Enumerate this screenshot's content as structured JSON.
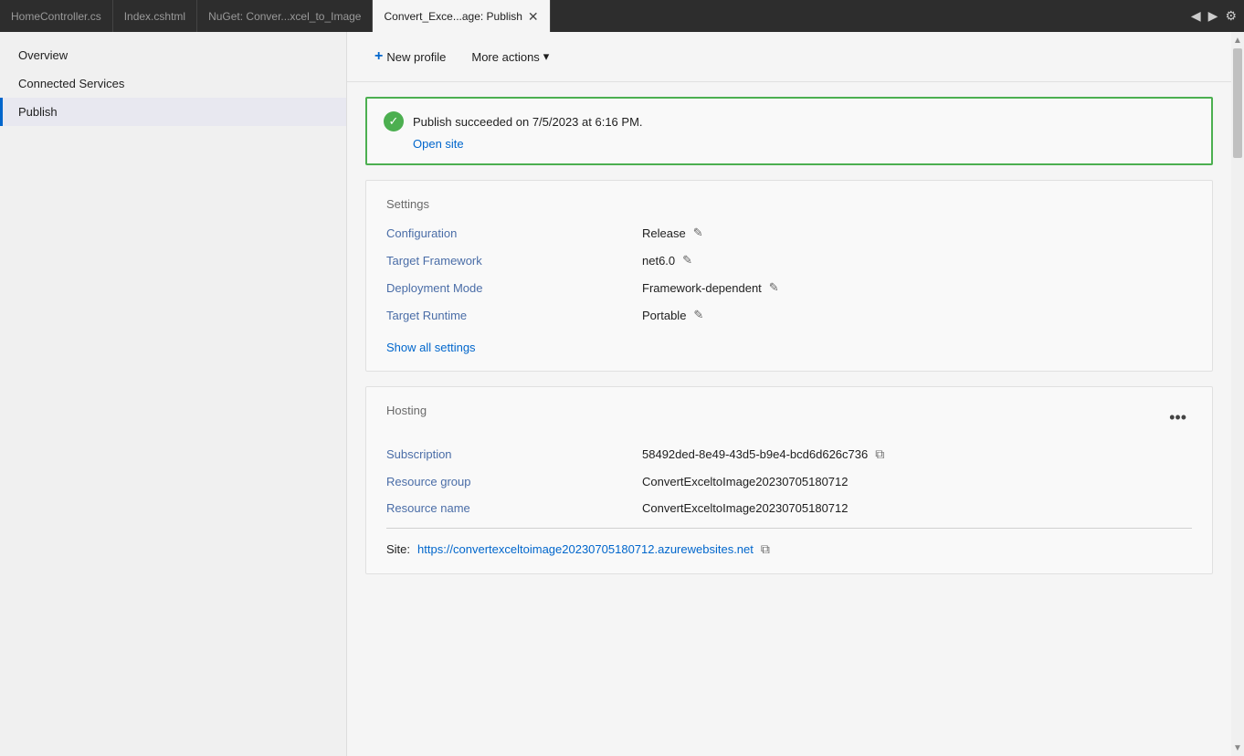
{
  "tabs": [
    {
      "id": "tab-homecontroller",
      "label": "HomeController.cs",
      "active": false,
      "closeable": false
    },
    {
      "id": "tab-index",
      "label": "Index.cshtml",
      "active": false,
      "closeable": false
    },
    {
      "id": "tab-nuget",
      "label": "NuGet: Conver...xcel_to_Image",
      "active": false,
      "closeable": false
    },
    {
      "id": "tab-publish",
      "label": "Convert_Exce...age: Publish",
      "active": true,
      "closeable": true
    }
  ],
  "sidebar": {
    "items": [
      {
        "id": "overview",
        "label": "Overview",
        "active": false
      },
      {
        "id": "connected-services",
        "label": "Connected Services",
        "active": false
      },
      {
        "id": "publish",
        "label": "Publish",
        "active": true
      }
    ]
  },
  "toolbar": {
    "new_profile_label": "New profile",
    "more_actions_label": "More actions"
  },
  "publish_result": {
    "message": "Publish succeeded on 7/5/2023 at 6:16 PM.",
    "open_site_label": "Open site"
  },
  "settings": {
    "section_title": "Settings",
    "rows": [
      {
        "label": "Configuration",
        "value": "Release"
      },
      {
        "label": "Target Framework",
        "value": "net6.0"
      },
      {
        "label": "Deployment Mode",
        "value": "Framework-dependent"
      },
      {
        "label": "Target Runtime",
        "value": "Portable"
      }
    ],
    "show_all_label": "Show all settings"
  },
  "hosting": {
    "section_title": "Hosting",
    "rows": [
      {
        "label": "Subscription",
        "value": "58492ded-8e49-43d5-b9e4-bcd6d626c736",
        "copy": true
      },
      {
        "label": "Resource group",
        "value": "ConvertExceltoImage20230705180712",
        "copy": false
      },
      {
        "label": "Resource name",
        "value": "ConvertExceltoImage20230705180712",
        "copy": false
      }
    ],
    "site_label": "Site:",
    "site_url": "https://convertexceltoimage20230705180712.azurewebsites.net"
  },
  "icons": {
    "plus": "+",
    "dropdown": "▾",
    "checkmark": "✓",
    "pencil": "✎",
    "copy": "⧉",
    "more": "•••",
    "scroll_up": "▲",
    "scroll_down": "▼",
    "pin": "📌",
    "close": "✕"
  }
}
